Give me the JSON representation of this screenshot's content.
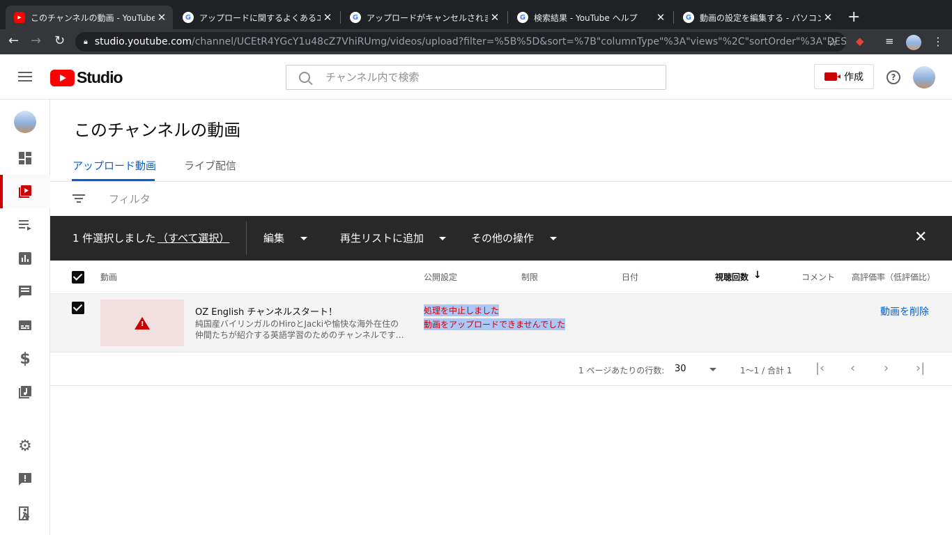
{
  "browser": {
    "tabs": [
      {
        "title": "このチャンネルの動画 - YouTube Studio",
        "favicon": "youtube-studio-icon",
        "active": true
      },
      {
        "title": "アップロードに関するよくあるエラー",
        "favicon": "google-icon",
        "active": false
      },
      {
        "title": "アップロードがキャンセルされました",
        "favicon": "google-icon",
        "active": false
      },
      {
        "title": "検索結果 - YouTube ヘルプ",
        "favicon": "google-icon",
        "active": false
      },
      {
        "title": "動画の設定を編集する - パソコン - YouTube",
        "favicon": "google-icon",
        "active": false
      }
    ],
    "url_host": "studio.youtube.com",
    "url_path": "/channel/UCEtR4YGcY1u48cZ7VhiRUmg/videos/upload?filter=%5B%5D&sort=%7B\"columnType\"%3A\"views\"%2C\"sortOrder\"%3A\"DES…"
  },
  "header": {
    "logo_text": "Studio",
    "search_placeholder": "チャンネル内で検索",
    "create_label": "作成"
  },
  "page": {
    "title": "このチャンネルの動画",
    "tabs": [
      "アップロード動画",
      "ライブ配信"
    ],
    "filter_placeholder": "フィルタ"
  },
  "bulk_bar": {
    "selected_text": "1 件選択しました",
    "select_all": "（すべて選択）",
    "actions": [
      "編集",
      "再生リストに追加",
      "その他の操作"
    ]
  },
  "table": {
    "columns": [
      "動画",
      "公開設定",
      "制限",
      "日付",
      "視聴回数",
      "コメント",
      "高評価率（低評価比）"
    ],
    "sorted_column": "視聴回数",
    "sort_direction": "descending",
    "rows": [
      {
        "title": "OZ English チャンネルスタート！",
        "description": "純国産バイリンガルのHiroとJackiや愉快な海外在住の仲間たちが紹介する英語学習のためのチャンネルです…",
        "status_line1": "処理を中止しました",
        "status_line2": "動画をアップロードできませんでした",
        "action": "動画を削除",
        "selected": true
      }
    ]
  },
  "pagination": {
    "rows_per_page_label": "1 ページあたりの行数:",
    "rows_per_page": "30",
    "range": "1〜1 / 合計 1"
  },
  "colors": {
    "accent": "#065fd4",
    "brand": "#ff0000",
    "error": "#cc0000",
    "bulk_bar": "#282828"
  }
}
